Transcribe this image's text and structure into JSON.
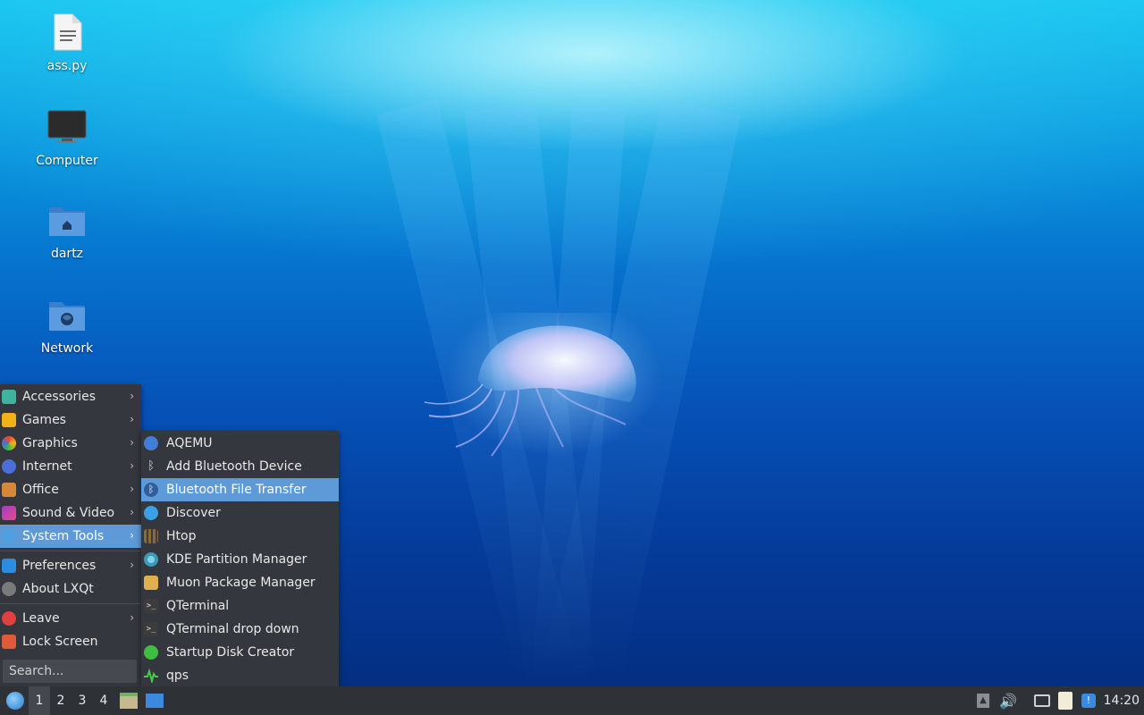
{
  "desktop": {
    "icons": [
      {
        "label": "ass.py",
        "icon": "text-file-icon"
      },
      {
        "label": "Computer",
        "icon": "monitor-icon"
      },
      {
        "label": "dartz",
        "icon": "home-folder-icon"
      },
      {
        "label": "Network",
        "icon": "network-folder-icon"
      }
    ]
  },
  "main_menu": {
    "items": [
      {
        "label": "Accessories",
        "icon": "accessories-icon",
        "color": "#3fb3a0",
        "has_submenu": true
      },
      {
        "label": "Games",
        "icon": "gamepad-icon",
        "color": "#f2b318",
        "has_submenu": true
      },
      {
        "label": "Graphics",
        "icon": "graphics-icon",
        "color": "#e8472f",
        "has_submenu": true
      },
      {
        "label": "Internet",
        "icon": "globe-icon",
        "color": "#4a6fd8",
        "has_submenu": true
      },
      {
        "label": "Office",
        "icon": "briefcase-icon",
        "color": "#d6883a",
        "has_submenu": true
      },
      {
        "label": "Sound & Video",
        "icon": "multimedia-icon",
        "color": "#9b3fc4",
        "has_submenu": true
      },
      {
        "label": "System Tools",
        "icon": "gear-icon",
        "color": "#4fa0e0",
        "has_submenu": true,
        "highlighted": true
      },
      {
        "label": "Preferences",
        "icon": "preferences-icon",
        "color": "#2c8de0",
        "has_submenu": true
      },
      {
        "label": "About LXQt",
        "icon": "info-icon",
        "color": "#7a7a7a",
        "has_submenu": false
      },
      {
        "label": "Leave",
        "icon": "power-icon",
        "color": "#e04040",
        "has_submenu": true
      },
      {
        "label": "Lock Screen",
        "icon": "lock-icon",
        "color": "#e05a3a",
        "has_submenu": false
      }
    ],
    "search_placeholder": "Search..."
  },
  "system_tools_menu": {
    "items": [
      {
        "label": "AQEMU",
        "icon": "aqemu-icon",
        "color": "#3f7fd8"
      },
      {
        "label": "Add Bluetooth Device",
        "icon": "bluetooth-icon",
        "color": "#34373d"
      },
      {
        "label": "Bluetooth File Transfer",
        "icon": "bluetooth-icon",
        "color": "#2f5f9a",
        "highlighted": true
      },
      {
        "label": "Discover",
        "icon": "discover-icon",
        "color": "#3aa0e8"
      },
      {
        "label": "Htop",
        "icon": "htop-icon",
        "color": "#8a6a3a"
      },
      {
        "label": "KDE Partition Manager",
        "icon": "partition-icon",
        "color": "#3a9ab8"
      },
      {
        "label": "Muon Package Manager",
        "icon": "package-icon",
        "color": "#e0b050"
      },
      {
        "label": "QTerminal",
        "icon": "terminal-icon",
        "color": "#3c3c3c"
      },
      {
        "label": "QTerminal drop down",
        "icon": "terminal-icon",
        "color": "#3c3c3c"
      },
      {
        "label": "Startup Disk Creator",
        "icon": "usb-icon",
        "color": "#3fbf3f"
      },
      {
        "label": "qps",
        "icon": "qps-icon",
        "color": "#3fcf4f"
      }
    ]
  },
  "taskbar": {
    "workspaces": [
      "1",
      "2",
      "3",
      "4"
    ],
    "active_workspace": "1",
    "clock": "14:20"
  }
}
